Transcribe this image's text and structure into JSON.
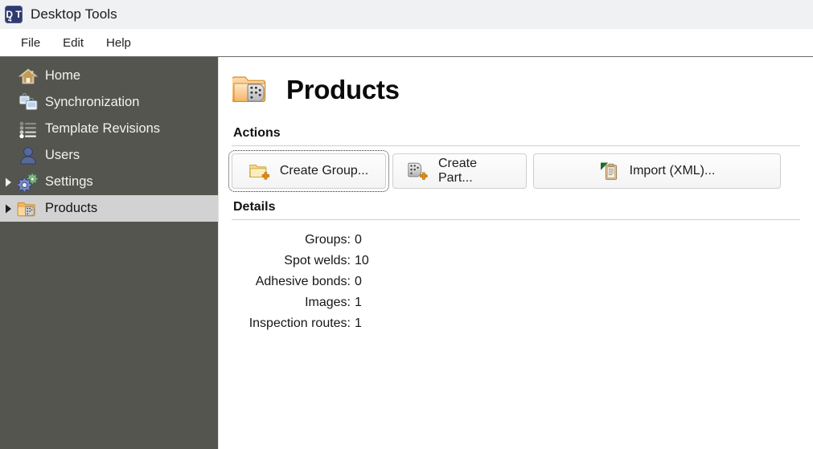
{
  "window": {
    "title": "Desktop Tools",
    "app_icon": "desktop-tools-icon",
    "app_icon_letters": "D T",
    "app_icon_sub": "4"
  },
  "menubar": {
    "items": [
      {
        "label": "File",
        "name": "menu-file"
      },
      {
        "label": "Edit",
        "name": "menu-edit"
      },
      {
        "label": "Help",
        "name": "menu-help"
      }
    ]
  },
  "sidebar": {
    "background": "#55554f",
    "selected_background": "#d2d2d2",
    "items": [
      {
        "label": "Home",
        "icon": "home-icon",
        "expandable": false,
        "selected": false
      },
      {
        "label": "Synchronization",
        "icon": "synchronization-icon",
        "expandable": false,
        "selected": false
      },
      {
        "label": "Template Revisions",
        "icon": "list-icon",
        "expandable": false,
        "selected": false
      },
      {
        "label": "Users",
        "icon": "user-icon",
        "expandable": false,
        "selected": false
      },
      {
        "label": "Settings",
        "icon": "gears-icon",
        "expandable": true,
        "selected": false
      },
      {
        "label": "Products",
        "icon": "products-folder-icon",
        "expandable": true,
        "selected": true
      }
    ]
  },
  "main": {
    "page_title": "Products",
    "page_icon": "products-folder-icon",
    "actions": {
      "heading": "Actions",
      "buttons": [
        {
          "label": "Create Group...",
          "icon": "folder-add-icon",
          "name": "create-group-button",
          "focused": true
        },
        {
          "label": "Create Part...",
          "icon": "part-add-icon",
          "name": "create-part-button",
          "focused": false
        },
        {
          "label": "Import (XML)...",
          "icon": "import-xml-icon",
          "name": "import-xml-button",
          "focused": false
        }
      ]
    },
    "details": {
      "heading": "Details",
      "rows": [
        {
          "label": "Groups:",
          "value": "0"
        },
        {
          "label": "Spot welds:",
          "value": "10"
        },
        {
          "label": "Adhesive bonds:",
          "value": "0"
        },
        {
          "label": "Images:",
          "value": "1"
        },
        {
          "label": "Inspection routes:",
          "value": "1"
        }
      ]
    }
  },
  "colors": {
    "sidebar_bg": "#55554f",
    "selection_bg": "#d2d2d2",
    "titlebar_bg": "#f0f1f3",
    "accent_orange": "#f0a030",
    "content_bg": "#ffffff"
  }
}
